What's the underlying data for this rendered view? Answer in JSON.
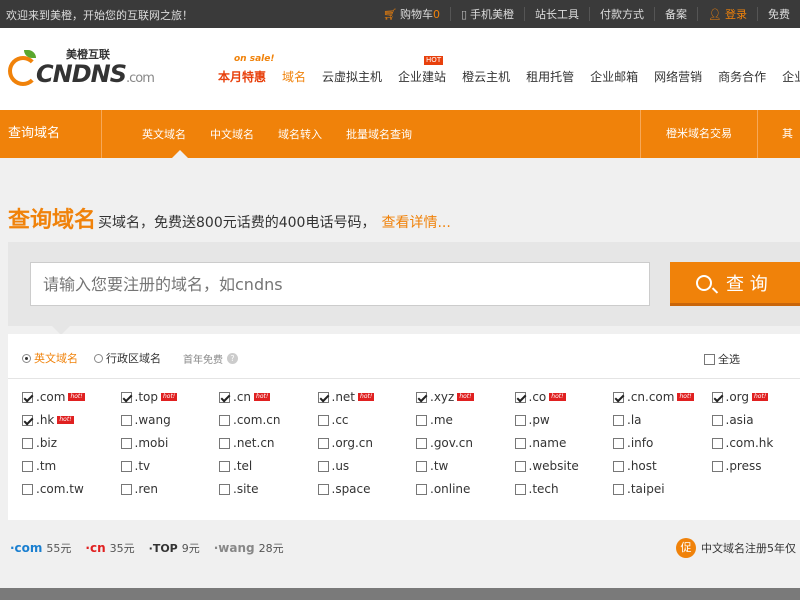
{
  "topbar": {
    "welcome": "欢迎来到美橙，开始您的互联网之旅！",
    "cart_label": "购物车",
    "cart_count": "0",
    "mobile": "手机美橙",
    "tools": "站长工具",
    "payment": "付款方式",
    "record": "备案",
    "login": "登录",
    "register": "免费"
  },
  "logo": {
    "cn_title": "美橙互联",
    "brand": "CNDNS",
    "brand_suffix": ".com"
  },
  "nav": {
    "onsale_tag": "on sale!",
    "hot_tag": "HOT",
    "items": [
      "本月特惠",
      "域名",
      "云虚拟主机",
      "企业建站",
      "橙云主机",
      "租用托管",
      "企业邮箱",
      "网络营销",
      "商务合作",
      "企业"
    ]
  },
  "subnav": {
    "title": "查询域名",
    "links": [
      "英文域名",
      "中文域名",
      "域名转入",
      "批量域名查询"
    ],
    "right1": "橙米域名交易",
    "right2": "其"
  },
  "headline": {
    "title": "查询域名",
    "subtitle": "买域名，免费送800元话费的400电话号码，",
    "more": "查看详情..."
  },
  "search": {
    "placeholder": "请输入您要注册的域名，如cndns",
    "button": "查 询"
  },
  "options": {
    "tab_en": "英文域名",
    "tab_region": "行政区域名",
    "first_year_free": "首年免费",
    "help": "?",
    "select_all": "全选"
  },
  "hot_badge": "hot!",
  "tlds": [
    {
      "name": ".com",
      "checked": true,
      "hot": true
    },
    {
      "name": ".top",
      "checked": true,
      "hot": true
    },
    {
      "name": ".cn",
      "checked": true,
      "hot": true
    },
    {
      "name": ".net",
      "checked": true,
      "hot": true
    },
    {
      "name": ".xyz",
      "checked": true,
      "hot": true
    },
    {
      "name": ".co",
      "checked": true,
      "hot": true
    },
    {
      "name": ".cn.com",
      "checked": true,
      "hot": true
    },
    {
      "name": ".org",
      "checked": true,
      "hot": true
    },
    {
      "name": ".hk",
      "checked": true,
      "hot": true
    },
    {
      "name": ".wang",
      "checked": false,
      "hot": false
    },
    {
      "name": ".com.cn",
      "checked": false,
      "hot": false
    },
    {
      "name": ".cc",
      "checked": false,
      "hot": false
    },
    {
      "name": ".me",
      "checked": false,
      "hot": false
    },
    {
      "name": ".pw",
      "checked": false,
      "hot": false
    },
    {
      "name": ".la",
      "checked": false,
      "hot": false
    },
    {
      "name": ".asia",
      "checked": false,
      "hot": false
    },
    {
      "name": ".biz",
      "checked": false,
      "hot": false
    },
    {
      "name": ".mobi",
      "checked": false,
      "hot": false
    },
    {
      "name": ".net.cn",
      "checked": false,
      "hot": false
    },
    {
      "name": ".org.cn",
      "checked": false,
      "hot": false
    },
    {
      "name": ".gov.cn",
      "checked": false,
      "hot": false
    },
    {
      "name": ".name",
      "checked": false,
      "hot": false
    },
    {
      "name": ".info",
      "checked": false,
      "hot": false
    },
    {
      "name": ".com.hk",
      "checked": false,
      "hot": false
    },
    {
      "name": ".tm",
      "checked": false,
      "hot": false
    },
    {
      "name": ".tv",
      "checked": false,
      "hot": false
    },
    {
      "name": ".tel",
      "checked": false,
      "hot": false
    },
    {
      "name": ".us",
      "checked": false,
      "hot": false
    },
    {
      "name": ".tw",
      "checked": false,
      "hot": false
    },
    {
      "name": ".website",
      "checked": false,
      "hot": false
    },
    {
      "name": ".host",
      "checked": false,
      "hot": false
    },
    {
      "name": ".press",
      "checked": false,
      "hot": false
    },
    {
      "name": ".com.tw",
      "checked": false,
      "hot": false
    },
    {
      "name": ".ren",
      "checked": false,
      "hot": false
    },
    {
      "name": ".site",
      "checked": false,
      "hot": false
    },
    {
      "name": ".space",
      "checked": false,
      "hot": false
    },
    {
      "name": ".online",
      "checked": false,
      "hot": false
    },
    {
      "name": ".tech",
      "checked": false,
      "hot": false
    },
    {
      "name": ".taipei",
      "checked": false,
      "hot": false
    }
  ],
  "prices": [
    {
      "name": "·com",
      "amount": "55元"
    },
    {
      "name": "·cn",
      "amount": "35元"
    },
    {
      "name": "·TOP",
      "amount": "9元"
    },
    {
      "name": "·wang",
      "amount": "28元"
    }
  ],
  "promo": {
    "badge": "促",
    "text": "中文域名注册5年仅"
  },
  "colors": {
    "accent": "#f0820a",
    "topbar": "#3a3a3a",
    "hot": "#e02020"
  }
}
